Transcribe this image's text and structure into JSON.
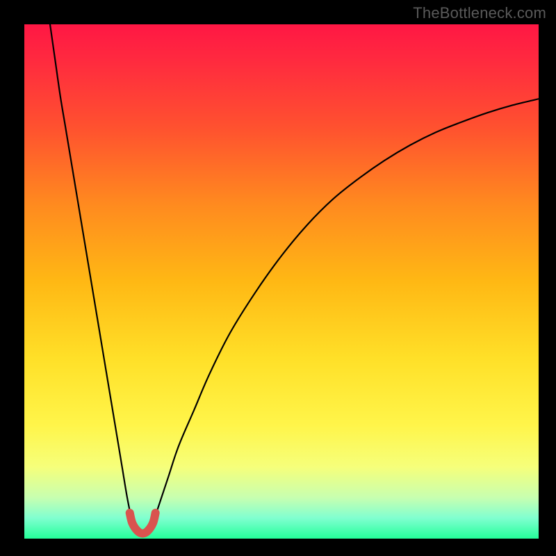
{
  "watermark": "TheBottleneck.com",
  "chart_data": {
    "type": "line",
    "title": "",
    "xlabel": "",
    "ylabel": "",
    "xlim": [
      0,
      100
    ],
    "ylim": [
      0,
      100
    ],
    "grid": false,
    "legend": false,
    "annotations": [],
    "gradient_stops": [
      {
        "offset": 0.0,
        "color": "#ff1744"
      },
      {
        "offset": 0.07,
        "color": "#ff2a3f"
      },
      {
        "offset": 0.2,
        "color": "#ff512f"
      },
      {
        "offset": 0.35,
        "color": "#ff8a1f"
      },
      {
        "offset": 0.5,
        "color": "#ffb814"
      },
      {
        "offset": 0.65,
        "color": "#ffe028"
      },
      {
        "offset": 0.78,
        "color": "#fff54a"
      },
      {
        "offset": 0.86,
        "color": "#f6ff7a"
      },
      {
        "offset": 0.92,
        "color": "#c8ffb0"
      },
      {
        "offset": 0.96,
        "color": "#80ffd0"
      },
      {
        "offset": 1.0,
        "color": "#24ff9a"
      }
    ],
    "series": [
      {
        "name": "left-branch",
        "x": [
          5,
          6,
          7,
          8,
          9,
          10,
          11,
          12,
          13,
          14,
          15,
          16,
          17,
          18,
          19,
          20,
          21
        ],
        "values": [
          100,
          93,
          86,
          80,
          74,
          68,
          62,
          56,
          50,
          44,
          38,
          32,
          26,
          20,
          14,
          8,
          3
        ]
      },
      {
        "name": "right-branch",
        "x": [
          25,
          26,
          28,
          30,
          33,
          36,
          40,
          45,
          50,
          55,
          60,
          65,
          70,
          75,
          80,
          85,
          90,
          95,
          100
        ],
        "values": [
          3,
          6,
          12,
          18,
          25,
          32,
          40,
          48,
          55,
          61,
          66,
          70,
          73.5,
          76.5,
          79,
          81,
          82.8,
          84.3,
          85.5
        ]
      },
      {
        "name": "valley-marker",
        "x": [
          20.5,
          21,
          22,
          23,
          24,
          25,
          25.5
        ],
        "values": [
          5,
          3,
          1.5,
          1,
          1.5,
          3,
          5
        ]
      }
    ],
    "colors": {
      "curve": "#000000",
      "marker": "#d9544f"
    }
  }
}
